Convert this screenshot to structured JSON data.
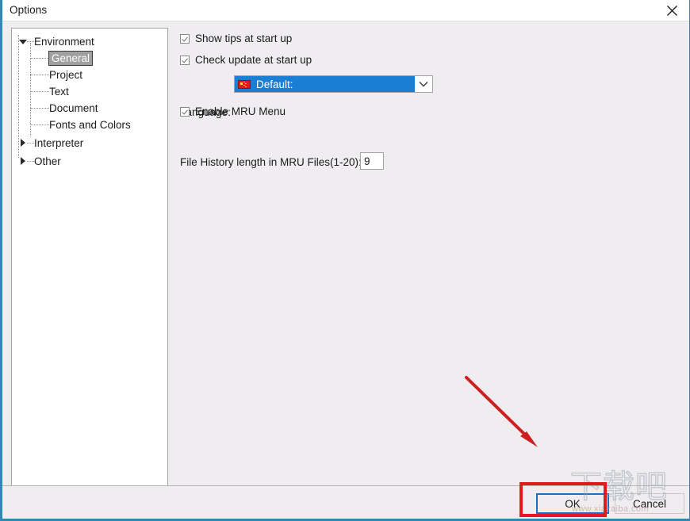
{
  "window": {
    "title": "Options",
    "close_icon": "close-icon"
  },
  "tree": {
    "nodes": [
      {
        "label": "Environment",
        "level": 0,
        "expander": "open",
        "selected": false
      },
      {
        "label": "General",
        "level": 1,
        "expander": "none",
        "selected": true
      },
      {
        "label": "Project",
        "level": 1,
        "expander": "none",
        "selected": false
      },
      {
        "label": "Text",
        "level": 1,
        "expander": "none",
        "selected": false
      },
      {
        "label": "Document",
        "level": 1,
        "expander": "none",
        "selected": false
      },
      {
        "label": "Fonts and Colors",
        "level": 1,
        "expander": "none",
        "selected": false
      },
      {
        "label": "Interpreter",
        "level": 0,
        "expander": "closed",
        "selected": false
      },
      {
        "label": "Other",
        "level": 0,
        "expander": "closed",
        "selected": false
      }
    ]
  },
  "settings": {
    "show_tips": {
      "label": "Show tips at start up",
      "checked": true
    },
    "check_update": {
      "label": "Check update at start up",
      "checked": true
    },
    "language": {
      "label": "Language:",
      "value": "Default:",
      "flag_icon": "china-flag-icon",
      "arrow_icon": "chevron-down-icon",
      "highlight_color": "#1a7fd4"
    },
    "enable_mru": {
      "label": "Enable MRU Menu",
      "checked": true
    },
    "mru_length": {
      "label": "File History length in MRU Files(1-20):",
      "value": "9"
    }
  },
  "footer": {
    "ok_label": "OK",
    "cancel_label": "Cancel"
  },
  "annotations": {
    "arrow_color": "#cc2020",
    "box_color": "#e01b1b"
  },
  "watermark": {
    "glyphs": "下载吧",
    "url": "www.xiazaiba.com"
  }
}
